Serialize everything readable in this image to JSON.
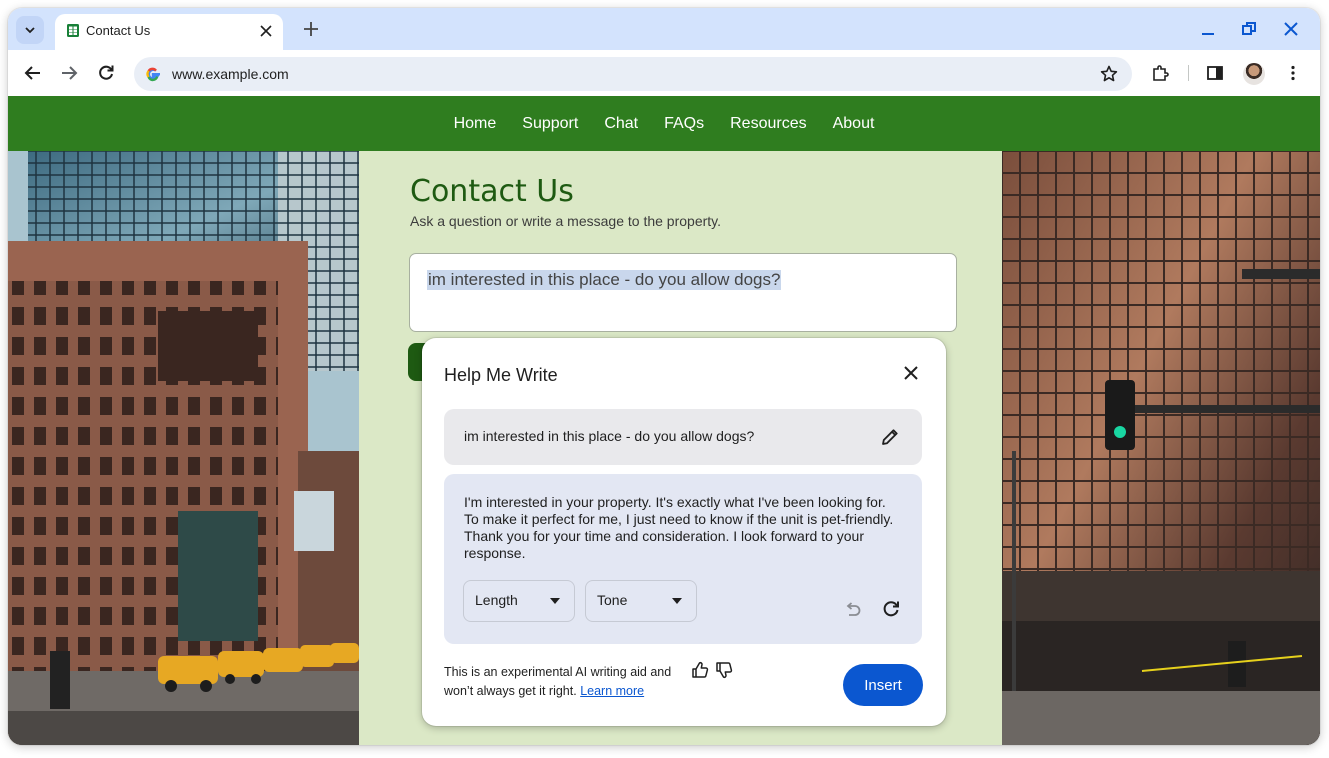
{
  "browser": {
    "tab_title": "Contact Us",
    "url": "www.example.com"
  },
  "site": {
    "nav": [
      "Home",
      "Support",
      "Chat",
      "FAQs",
      "Resources",
      "About"
    ],
    "title": "Contact Us",
    "subtitle": "Ask a question or write a message to the property.",
    "message_value": "im interested in this place - do you allow dogs?"
  },
  "dialog": {
    "title": "Help Me Write",
    "prompt": "im interested in this place - do you allow dogs?",
    "result": "I'm interested in your property. It's exactly what I've been looking for. To make it perfect for me, I just need to know if the unit is pet-friendly. Thank you for your time and consideration. I look forward to your response.",
    "length_label": "Length",
    "tone_label": "Tone",
    "disclaimer_line1": "This is an experimental AI writing aid and",
    "disclaimer_line2": "won’t always get it right.",
    "learn_more": "Learn more",
    "insert_label": "Insert"
  },
  "colors": {
    "nav_green": "#2f7d1f",
    "page_bg": "#dbe8c6",
    "title_green": "#1e5a12",
    "insert_blue": "#0b57d0",
    "tabstrip": "#d3e3fd"
  },
  "icons": [
    "tab-search-icon",
    "spreadsheet-favicon-icon",
    "close-icon",
    "plus-icon",
    "minimize-icon",
    "restore-icon",
    "back-icon",
    "forward-icon",
    "reload-icon",
    "google-icon",
    "star-icon",
    "extensions-icon",
    "side-panel-icon",
    "menu-icon",
    "pencil-icon",
    "undo-icon",
    "refresh-icon",
    "thumbs-up-icon",
    "thumbs-down-icon",
    "caret-down-icon"
  ]
}
